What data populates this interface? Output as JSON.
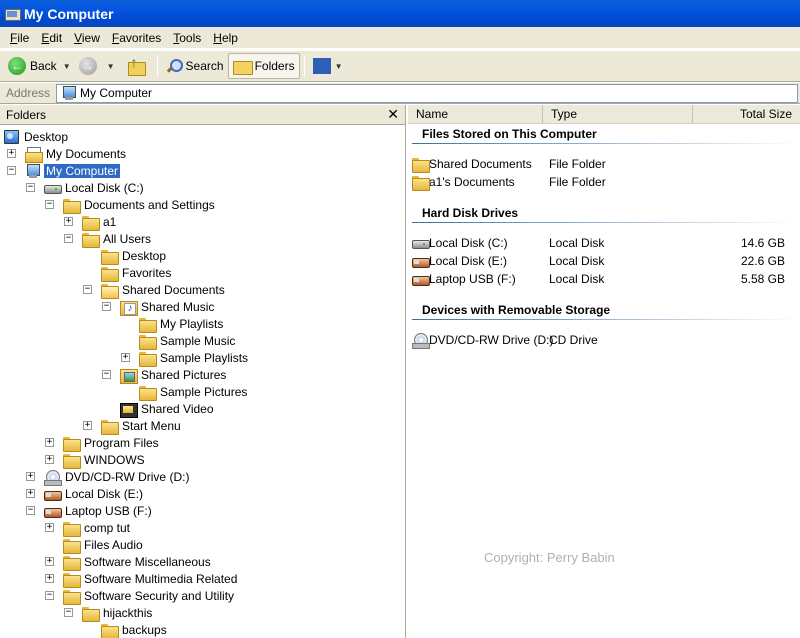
{
  "window": {
    "title": "My Computer"
  },
  "menu": [
    {
      "key": "F",
      "rest": "ile"
    },
    {
      "key": "E",
      "rest": "dit"
    },
    {
      "key": "V",
      "rest": "iew"
    },
    {
      "key": "F",
      "rest": "avorites",
      "pre": ""
    },
    {
      "key": "T",
      "rest": "ools"
    },
    {
      "key": "H",
      "rest": "elp"
    }
  ],
  "toolbar": {
    "back": "Back",
    "search": "Search",
    "folders": "Folders"
  },
  "address": {
    "label": "Address",
    "value": "My Computer"
  },
  "folders_pane": {
    "title": "Folders",
    "close": "✕"
  },
  "tree": [
    {
      "label": "Desktop",
      "icon": "desktop",
      "depth": 0,
      "pm": "none"
    },
    {
      "label": "My Documents",
      "icon": "docs",
      "depth": 1,
      "pm": "+"
    },
    {
      "label": "My Computer",
      "icon": "computer",
      "depth": 1,
      "pm": "-",
      "selected": true
    },
    {
      "label": "Local Disk (C:)",
      "icon": "disk",
      "depth": 2,
      "pm": "-"
    },
    {
      "label": "Documents and Settings",
      "icon": "folder",
      "depth": 3,
      "pm": "-"
    },
    {
      "label": "a1",
      "icon": "folder",
      "depth": 4,
      "pm": "+"
    },
    {
      "label": "All Users",
      "icon": "folder",
      "depth": 4,
      "pm": "-"
    },
    {
      "label": "Desktop",
      "icon": "folder",
      "depth": 5,
      "pm": "none"
    },
    {
      "label": "Favorites",
      "icon": "folder",
      "depth": 5,
      "pm": "none"
    },
    {
      "label": "Shared Documents",
      "icon": "folder open",
      "depth": 5,
      "pm": "-"
    },
    {
      "label": "Shared Music",
      "icon": "music",
      "depth": 6,
      "pm": "-"
    },
    {
      "label": "My Playlists",
      "icon": "folder",
      "depth": 7,
      "pm": "none"
    },
    {
      "label": "Sample Music",
      "icon": "folder",
      "depth": 7,
      "pm": "none"
    },
    {
      "label": "Sample Playlists",
      "icon": "folder",
      "depth": 7,
      "pm": "+"
    },
    {
      "label": "Shared Pictures",
      "icon": "pictures",
      "depth": 6,
      "pm": "-"
    },
    {
      "label": "Sample Pictures",
      "icon": "folder",
      "depth": 7,
      "pm": "none"
    },
    {
      "label": "Shared Video",
      "icon": "video",
      "depth": 6,
      "pm": "none"
    },
    {
      "label": "Start Menu",
      "icon": "folder",
      "depth": 5,
      "pm": "+"
    },
    {
      "label": "Program Files",
      "icon": "folder",
      "depth": 3,
      "pm": "+"
    },
    {
      "label": "WINDOWS",
      "icon": "folder",
      "depth": 3,
      "pm": "+"
    },
    {
      "label": "DVD/CD-RW Drive (D:)",
      "icon": "cd",
      "depth": 2,
      "pm": "+"
    },
    {
      "label": "Local Disk (E:)",
      "icon": "usb",
      "depth": 2,
      "pm": "+"
    },
    {
      "label": "Laptop USB (F:)",
      "icon": "usb",
      "depth": 2,
      "pm": "-"
    },
    {
      "label": "comp tut",
      "icon": "folder",
      "depth": 3,
      "pm": "+"
    },
    {
      "label": "Files Audio",
      "icon": "folder",
      "depth": 3,
      "pm": "none"
    },
    {
      "label": "Software Miscellaneous",
      "icon": "folder",
      "depth": 3,
      "pm": "+"
    },
    {
      "label": "Software Multimedia Related",
      "icon": "folder",
      "depth": 3,
      "pm": "+"
    },
    {
      "label": "Software Security and Utility",
      "icon": "folder",
      "depth": 3,
      "pm": "-"
    },
    {
      "label": "hijackthis",
      "icon": "folder",
      "depth": 4,
      "pm": "-"
    },
    {
      "label": "backups",
      "icon": "folder",
      "depth": 5,
      "pm": "none"
    }
  ],
  "columns": {
    "name": "Name",
    "type": "Type",
    "size": "Total Size"
  },
  "groups": [
    {
      "title": "Files Stored on This Computer",
      "items": [
        {
          "name": "Shared Documents",
          "type": "File Folder",
          "size": "",
          "icon": "folder"
        },
        {
          "name": "a1's Documents",
          "type": "File Folder",
          "size": "",
          "icon": "folder"
        }
      ]
    },
    {
      "title": "Hard Disk Drives",
      "items": [
        {
          "name": "Local Disk (C:)",
          "type": "Local Disk",
          "size": "14.6 GB",
          "icon": "disk"
        },
        {
          "name": "Local Disk (E:)",
          "type": "Local Disk",
          "size": "22.6 GB",
          "icon": "usb"
        },
        {
          "name": "Laptop USB (F:)",
          "type": "Local Disk",
          "size": "5.58 GB",
          "icon": "usb"
        }
      ]
    },
    {
      "title": "Devices with Removable Storage",
      "items": [
        {
          "name": "DVD/CD-RW Drive (D:)",
          "type": "CD Drive",
          "size": "",
          "icon": "cd"
        }
      ]
    }
  ],
  "watermark": "Copyright: Perry Babin"
}
